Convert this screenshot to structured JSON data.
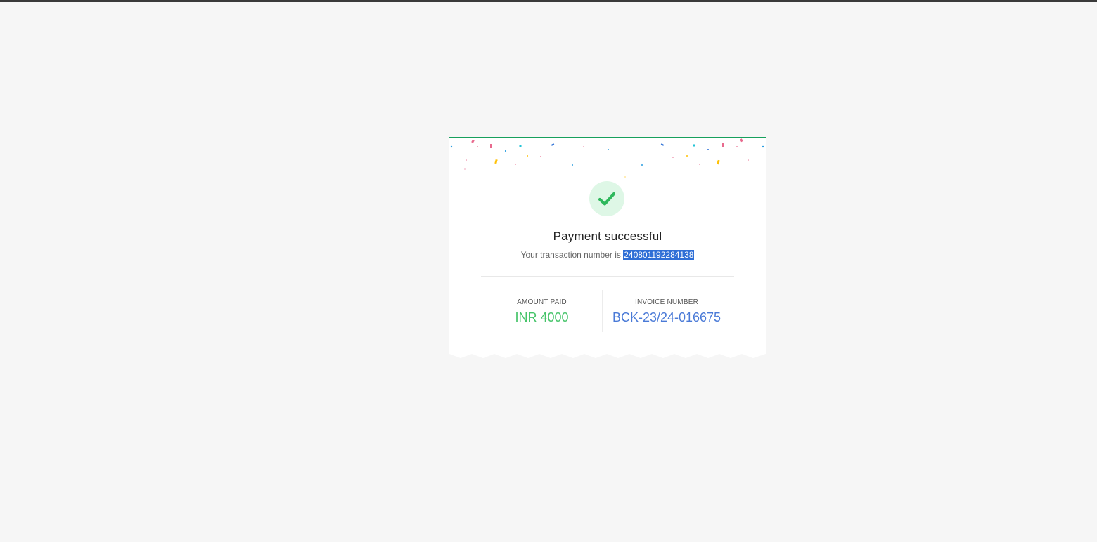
{
  "payment": {
    "title": "Payment successful",
    "transaction_prefix": "Your transaction number is",
    "transaction_number": "240801192284138",
    "amount_label": "AMOUNT PAID",
    "amount_value": "INR 4000",
    "invoice_label": "INVOICE NUMBER",
    "invoice_value": "BCK-23/24-016675"
  },
  "icons": {
    "success": "check-mark-icon",
    "decoration": "confetti"
  },
  "colors": {
    "accent_green": "#17a05d",
    "amount_green": "#46c46a",
    "invoice_blue": "#4a7ad7",
    "selection_blue": "#2f6fd6",
    "check_bg": "#def7e6"
  }
}
